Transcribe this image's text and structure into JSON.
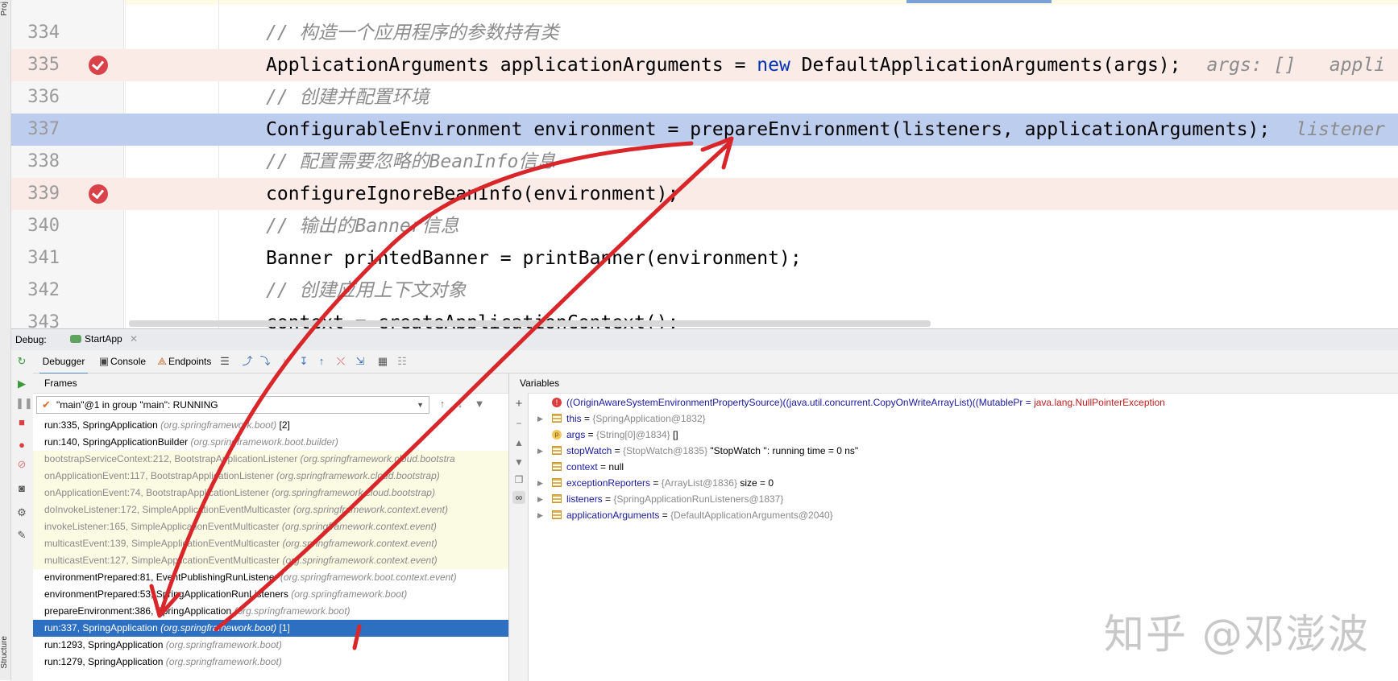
{
  "left_strip": {
    "top_label": "Proj",
    "bottom_label": "Structure"
  },
  "editor": {
    "lines": [
      {
        "num": "334",
        "code": "// 构造一个应用程序的参数持有类",
        "kind": "comment",
        "breakpoint": false
      },
      {
        "num": "335",
        "code": "ApplicationArguments applicationArguments = ",
        "kw": "new",
        "code2": " DefaultApplicationArguments(args);",
        "hint": "args: []   appli",
        "kind": "code",
        "breakpoint": true
      },
      {
        "num": "336",
        "code": "// 创建并配置环境",
        "kind": "comment",
        "breakpoint": false
      },
      {
        "num": "337",
        "code": "ConfigurableEnvironment environment = prepareEnvironment(listeners, applicationArguments);",
        "hint": "listener",
        "kind": "current",
        "breakpoint": false
      },
      {
        "num": "338",
        "code": "// 配置需要忽略的BeanInfo信息",
        "kind": "comment",
        "breakpoint": false
      },
      {
        "num": "339",
        "code": "configureIgnoreBeanInfo(environment);",
        "kind": "code",
        "breakpoint": true
      },
      {
        "num": "340",
        "code": "// 输出的Banner信息",
        "kind": "comment",
        "breakpoint": false
      },
      {
        "num": "341",
        "code": "Banner printedBanner = printBanner(environment);",
        "kind": "code",
        "breakpoint": false
      },
      {
        "num": "342",
        "code": "// 创建应用上下文对象",
        "kind": "comment",
        "breakpoint": false
      },
      {
        "num": "343",
        "code": "context = createApplicationContext();",
        "kind": "code",
        "breakpoint": false
      }
    ]
  },
  "debug": {
    "label": "Debug:",
    "session_tab": "StartApp",
    "toolbar": {
      "debugger": "Debugger",
      "console": "Console",
      "endpoints": "Endpoints"
    },
    "frames": {
      "header": "Frames",
      "thread": "\"main\"@1 in group \"main\": RUNNING",
      "items": [
        {
          "method": "run:335, SpringApplication",
          "pkg": "(org.springframework.boot)",
          "extra": " [2]",
          "style": "normal"
        },
        {
          "method": "run:140, SpringApplicationBuilder",
          "pkg": "(org.springframework.boot.builder)",
          "extra": "",
          "style": "normal"
        },
        {
          "method": "bootstrapServiceContext:212, BootstrapApplicationListener",
          "pkg": "(org.springframework.cloud.bootstra",
          "extra": "",
          "style": "lib"
        },
        {
          "method": "onApplicationEvent:117, BootstrapApplicationListener",
          "pkg": "(org.springframework.cloud.bootstrap)",
          "extra": "",
          "style": "lib"
        },
        {
          "method": "onApplicationEvent:74, BootstrapApplicationListener",
          "pkg": "(org.springframework.cloud.bootstrap)",
          "extra": "",
          "style": "lib"
        },
        {
          "method": "doInvokeListener:172, SimpleApplicationEventMulticaster",
          "pkg": "(org.springframework.context.event)",
          "extra": "",
          "style": "lib"
        },
        {
          "method": "invokeListener:165, SimpleApplicationEventMulticaster",
          "pkg": "(org.springframework.context.event)",
          "extra": "",
          "style": "lib"
        },
        {
          "method": "multicastEvent:139, SimpleApplicationEventMulticaster",
          "pkg": "(org.springframework.context.event)",
          "extra": "",
          "style": "lib"
        },
        {
          "method": "multicastEvent:127, SimpleApplicationEventMulticaster",
          "pkg": "(org.springframework.context.event)",
          "extra": "",
          "style": "lib"
        },
        {
          "method": "environmentPrepared:81, EventPublishingRunListener",
          "pkg": "(org.springframework.boot.context.event)",
          "extra": "",
          "style": "normal"
        },
        {
          "method": "environmentPrepared:53, SpringApplicationRunListeners",
          "pkg": "(org.springframework.boot)",
          "extra": "",
          "style": "normal"
        },
        {
          "method": "prepareEnvironment:386, SpringApplication",
          "pkg": "(org.springframework.boot)",
          "extra": "",
          "style": "normal"
        },
        {
          "method": "run:337, SpringApplication",
          "pkg": "(org.springframework.boot)",
          "extra": " [1]",
          "style": "sel"
        },
        {
          "method": "run:1293, SpringApplication",
          "pkg": "(org.springframework.boot)",
          "extra": "",
          "style": "normal"
        },
        {
          "method": "run:1279, SpringApplication",
          "pkg": "(org.springframework.boot)",
          "extra": "",
          "style": "normal"
        }
      ]
    },
    "variables": {
      "header": "Variables",
      "items": [
        {
          "icon": "err",
          "expand": false,
          "name": "",
          "eq": "((OriginAwareSystemEnvironmentPropertySource)((java.util.concurrent.CopyOnWriteArrayList)((MutablePr = ",
          "type": "",
          "value": "",
          "exc": "java.lang.NullPointerException"
        },
        {
          "icon": "field",
          "expand": true,
          "name": "this",
          "eq": " = ",
          "type": "{SpringApplication@1832}",
          "value": "",
          "exc": ""
        },
        {
          "icon": "param",
          "expand": false,
          "name": "args",
          "eq": " = ",
          "type": "{String[0]@1834}",
          "value": " []",
          "exc": ""
        },
        {
          "icon": "field",
          "expand": true,
          "name": "stopWatch",
          "eq": " = ",
          "type": "{StopWatch@1835}",
          "value": " \"StopWatch '': running time = 0 ns\"",
          "exc": ""
        },
        {
          "icon": "field",
          "expand": false,
          "name": "context",
          "eq": " = null",
          "type": "",
          "value": "",
          "exc": ""
        },
        {
          "icon": "field",
          "expand": true,
          "name": "exceptionReporters",
          "eq": " = ",
          "type": "{ArrayList@1836}",
          "value": "  size = 0",
          "exc": ""
        },
        {
          "icon": "field",
          "expand": true,
          "name": "listeners",
          "eq": " = ",
          "type": "{SpringApplicationRunListeners@1837}",
          "value": "",
          "exc": ""
        },
        {
          "icon": "field",
          "expand": true,
          "name": "applicationArguments",
          "eq": " = ",
          "type": "{DefaultApplicationArguments@2040}",
          "value": "",
          "exc": ""
        }
      ]
    }
  },
  "watermark": "知乎 @邓澎波",
  "colors": {
    "current_line": "#bccdee",
    "breakpoint_line": "#fbebe7",
    "selected_frame": "#2d6fc1",
    "annotation_arrow": "#d8262a"
  }
}
